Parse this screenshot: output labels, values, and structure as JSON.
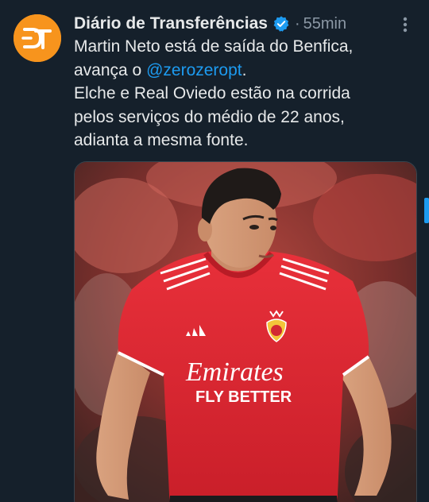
{
  "tweet": {
    "author_name": "Diário de Transferências",
    "separator": "·",
    "time": "55min",
    "body": {
      "line1": "Martin Neto está de saída do Benfica,",
      "line2_prefix": "avança o ",
      "mention": "@zerozeropt",
      "line2_suffix": ".",
      "line3": "Elche e Real Oviedo estão na corrida",
      "line4": "pelos serviços do médio de 22 anos,",
      "line5": "adianta a mesma fonte."
    },
    "avatar_logo": "DT",
    "jersey_sponsor_line1": "Emirates",
    "jersey_sponsor_line2": "FLY BETTER",
    "icons": {
      "avatar": "diario-transferencias-logo",
      "verified": "verified-badge-icon",
      "more": "more-options-icon"
    },
    "colors": {
      "background": "#15202b",
      "text": "#e7e9ea",
      "secondary": "#8b98a5",
      "accent": "#1d9bf0",
      "avatar_bg": "#f7941d",
      "jersey_red": "#e0242f"
    }
  }
}
